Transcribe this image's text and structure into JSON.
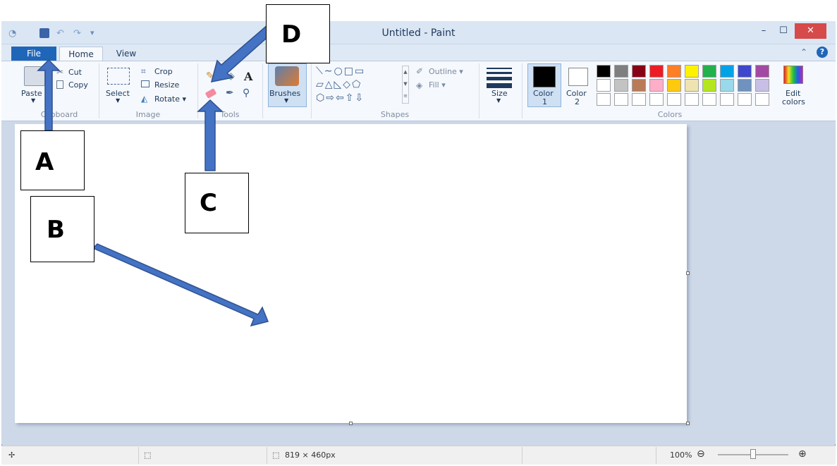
{
  "window": {
    "title": "Untitled - Paint",
    "min_label": "–",
    "max_label": "☐",
    "close_label": "✕"
  },
  "quick_access": {
    "app_icon": "paint-app-icon",
    "customize_label": "▾"
  },
  "tabs": [
    {
      "label": "File"
    },
    {
      "label": "Home"
    },
    {
      "label": "View"
    }
  ],
  "help_label": "?",
  "collapse_label": "⌃",
  "ribbon": {
    "clipboard": {
      "paste": "Paste",
      "cut": "Cut",
      "copy": "Copy",
      "group": "Clipboard"
    },
    "image": {
      "select": "Select",
      "crop": "Crop",
      "resize": "Resize",
      "rotate": "Rotate ▾",
      "group": "Image"
    },
    "tools": {
      "group": "Tools"
    },
    "brushes": {
      "label": "Brushes"
    },
    "shapes": {
      "outline": "Outline ▾",
      "fill": "Fill ▾",
      "group": "Shapes"
    },
    "size": {
      "label": "Size"
    },
    "colors": {
      "color1": "Color",
      "color1_num": "1",
      "color2": "Color",
      "color2_num": "2",
      "edit": "Edit",
      "edit2": "colors",
      "group": "Colors",
      "row1": [
        "#000000",
        "#7f7f7f",
        "#880015",
        "#ed1c24",
        "#ff7f27",
        "#fff200",
        "#22b14c",
        "#00a2e8",
        "#3f48cc",
        "#a349a4"
      ],
      "row2": [
        "#ffffff",
        "#c3c3c3",
        "#b97a57",
        "#ffaec9",
        "#ffc90e",
        "#efe4b0",
        "#b5e61d",
        "#99d9ea",
        "#7092be",
        "#c8bfe7"
      ]
    }
  },
  "status": {
    "canvas_size": "819 × 460px",
    "zoom": "100%",
    "zoom_level": 0.5
  },
  "annotations": [
    {
      "label": "A"
    },
    {
      "label": "B"
    },
    {
      "label": "C"
    },
    {
      "label": "D"
    }
  ]
}
